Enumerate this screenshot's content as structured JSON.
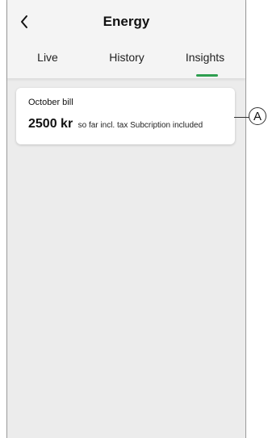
{
  "header": {
    "title": "Energy",
    "back_icon": "chevron-left-icon"
  },
  "tabs": [
    {
      "label": "Live",
      "active": false
    },
    {
      "label": "History",
      "active": false
    },
    {
      "label": "Insights",
      "active": true
    }
  ],
  "colors": {
    "accent": "#2e9e4f",
    "background": "#ececec"
  },
  "card": {
    "label": "October bill",
    "amount": "2500 kr",
    "description": "so far incl. tax Subcription included"
  },
  "callout": {
    "letter": "A"
  }
}
